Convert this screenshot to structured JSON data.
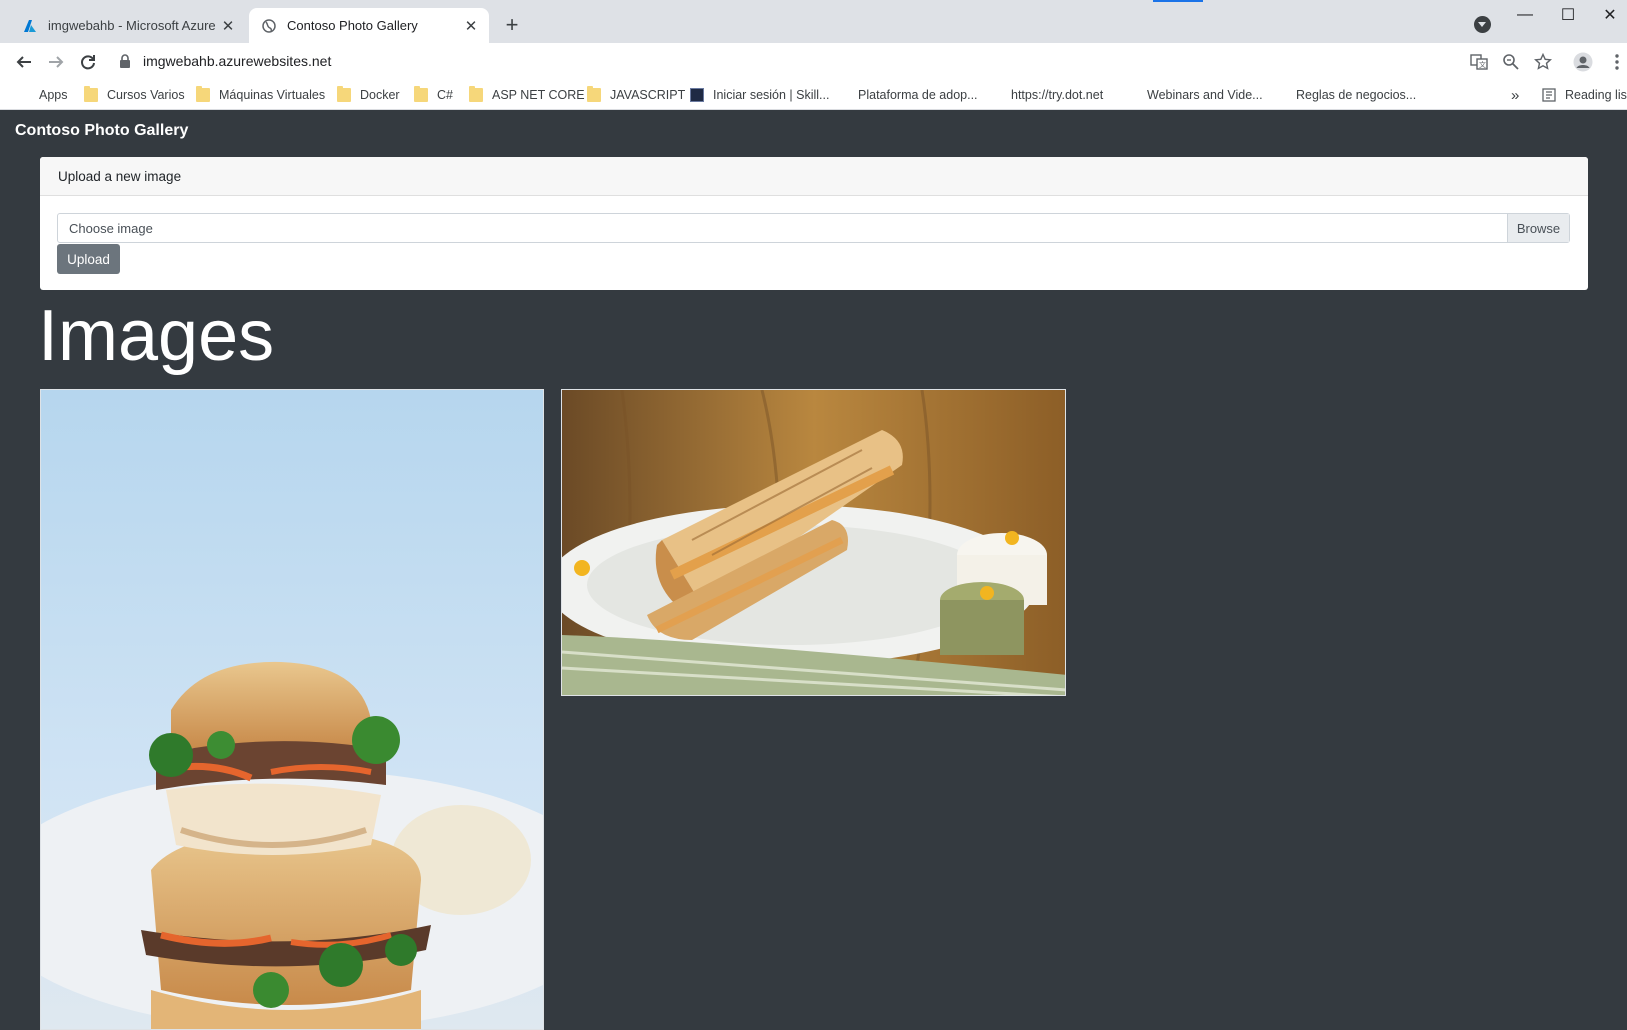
{
  "browser": {
    "tabs": [
      {
        "title": "imgwebahb - Microsoft Azure",
        "icon": "azure-icon",
        "active": false
      },
      {
        "title": "Contoso Photo Gallery",
        "icon": "globe-icon",
        "active": true
      }
    ],
    "url": "imgwebahb.azurewebsites.net",
    "accent": "#1a73e8"
  },
  "bookmarks": {
    "items": [
      {
        "label": "Apps",
        "icon": "apps-grid-icon"
      },
      {
        "label": "Cursos Varios",
        "icon": "folder-icon"
      },
      {
        "label": "Máquinas Virtuales",
        "icon": "folder-icon"
      },
      {
        "label": "Docker",
        "icon": "folder-icon"
      },
      {
        "label": "C#",
        "icon": "folder-icon"
      },
      {
        "label": "ASP NET CORE",
        "icon": "folder-icon"
      },
      {
        "label": "JAVASCRIPT",
        "icon": "folder-icon"
      },
      {
        "label": "Iniciar sesión | Skill...",
        "icon": "skillsoft-icon"
      },
      {
        "label": "Plataforma de adop...",
        "icon": "microsoft-logo-icon"
      },
      {
        "label": "https://try.dot.net",
        "icon": "microsoft-logo-icon"
      },
      {
        "label": "Webinars and Vide...",
        "icon": "microsoft-logo-icon"
      },
      {
        "label": "Reglas de negocios...",
        "icon": "microsoft-logo-icon"
      }
    ],
    "overflow": "»",
    "reading_list": "Reading list"
  },
  "page": {
    "brand": "Contoso Photo Gallery",
    "upload_card": {
      "header": "Upload a new image",
      "file_placeholder": "Choose image",
      "browse_label": "Browse",
      "upload_label": "Upload"
    },
    "images_heading": "Images",
    "images": [
      {
        "name": "sandwich-stack-photo"
      },
      {
        "name": "grilled-sandwich-photo"
      }
    ]
  },
  "colors": {
    "page_bg": "#343a40",
    "button_secondary": "#6c757d"
  }
}
